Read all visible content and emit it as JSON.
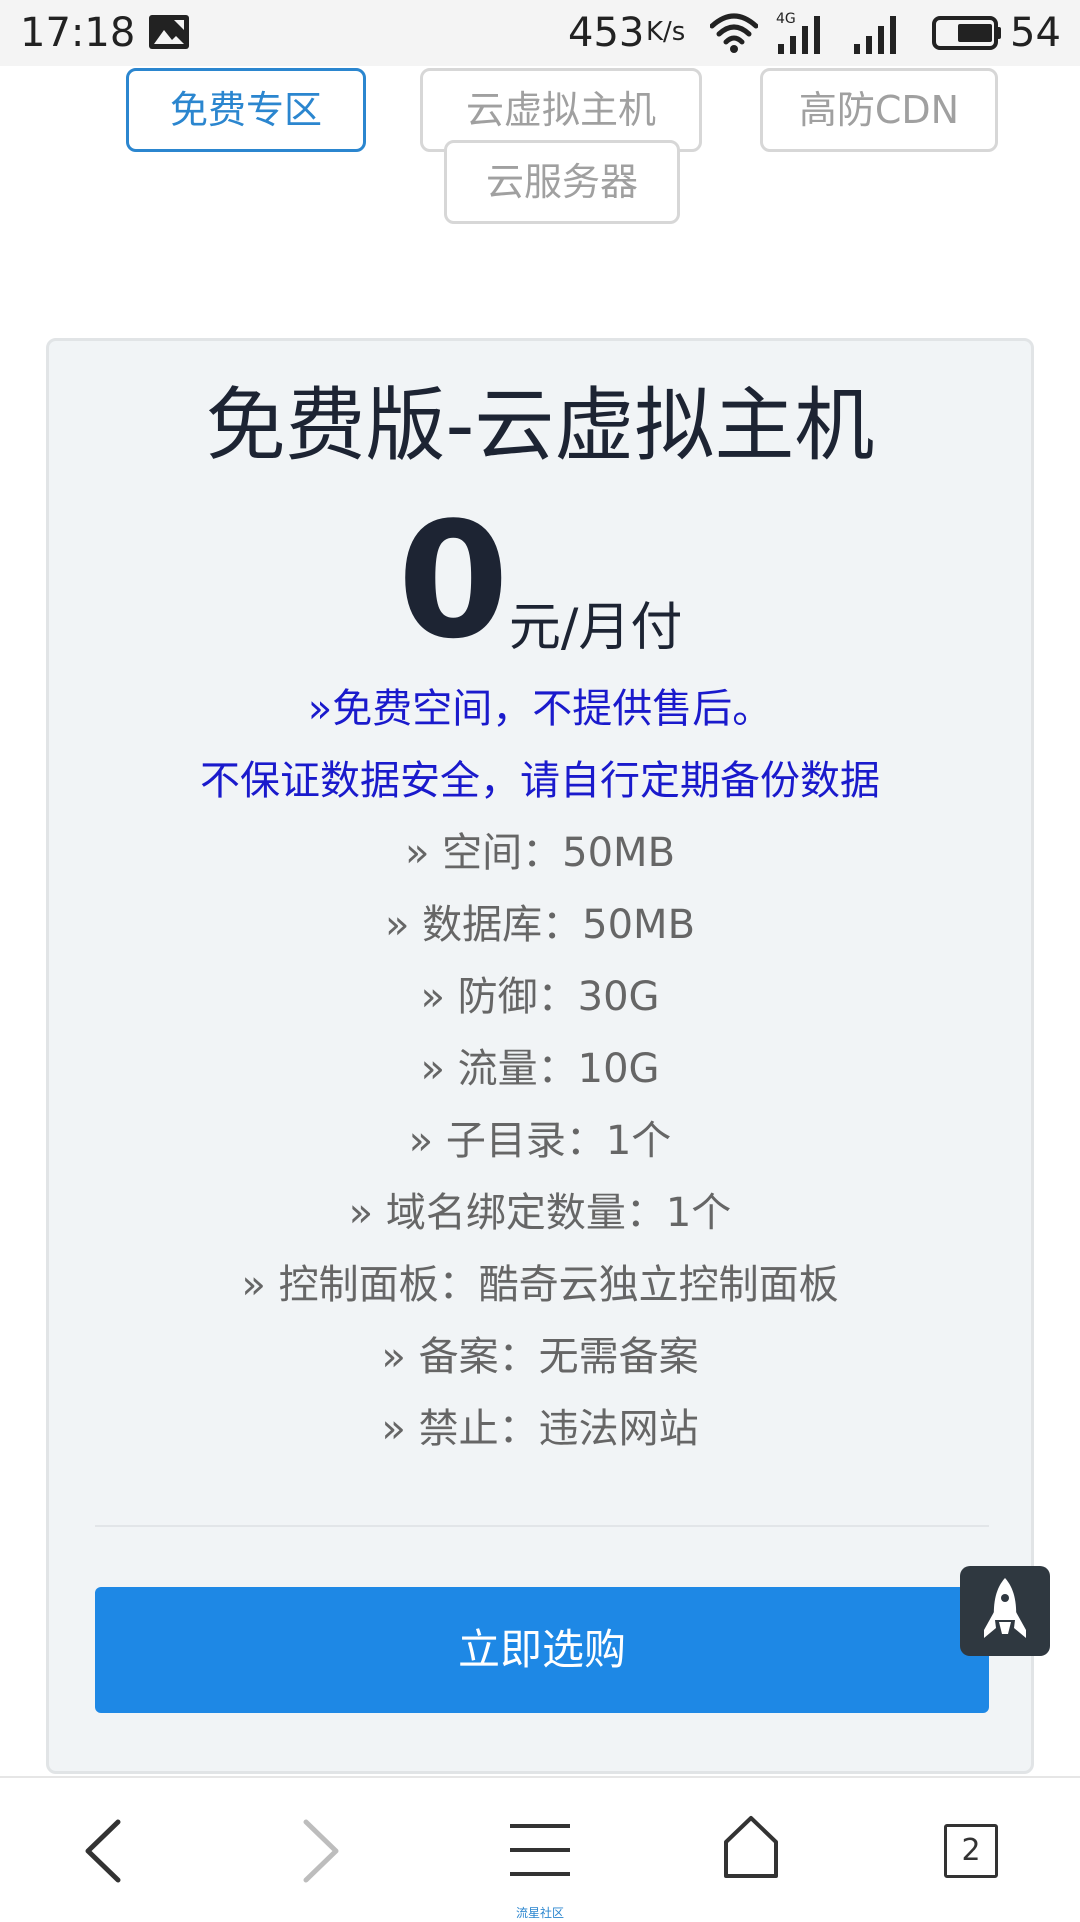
{
  "status_bar": {
    "time": "17:18",
    "net_speed": "453",
    "net_speed_unit": "K/s",
    "network_type": "4G",
    "battery": "54"
  },
  "tabs": [
    {
      "label": "免费专区",
      "active": true
    },
    {
      "label": "云虚拟主机",
      "active": false
    },
    {
      "label": "高防CDN",
      "active": false
    },
    {
      "label": "云服务器",
      "active": false
    }
  ],
  "plan": {
    "title": "免费版-云虚拟主机",
    "price": "0",
    "price_unit": "元/月付",
    "notice_line1": "»免费空间，不提供售后。",
    "notice_line2": "不保证数据安全，请自行定期备份数据",
    "features": [
      "» 空间：50MB",
      "» 数据库：50MB",
      "» 防御：30G",
      "» 流量：10G",
      "» 子目录：1个",
      "» 域名绑定数量：1个",
      "» 控制面板：酷奇云独立控制面板",
      "» 备案：无需备案",
      "» 禁止：违法网站"
    ],
    "buy_label": "立即选购"
  },
  "bottom_nav": {
    "tab_count": "2",
    "caption": "流星社区"
  },
  "colors": {
    "accent": "#2b86cf",
    "button": "#1e88e5",
    "notice": "#1a1acc",
    "feature_text": "#666666",
    "title_text": "#1d2433"
  }
}
